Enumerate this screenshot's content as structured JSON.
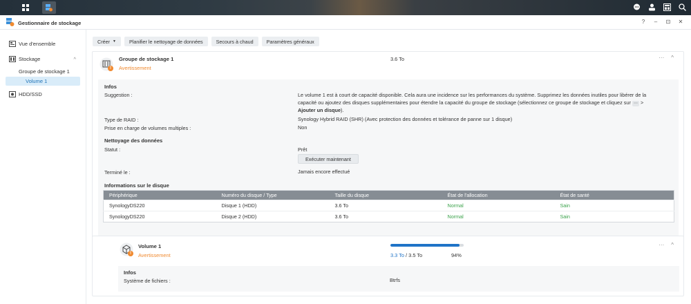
{
  "taskbar": {
    "icons": [
      "apps-grid-icon",
      "storage-manager-app-icon",
      "chat-icon",
      "user-icon",
      "widgets-icon",
      "search-icon"
    ]
  },
  "window": {
    "title": "Gestionnaire de stockage",
    "controls": [
      "?",
      "–",
      "⊡",
      "✕"
    ]
  },
  "sidebar": {
    "overview": "Vue d'ensemble",
    "storage": "Stockage",
    "pool": "Groupe de stockage 1",
    "volume": "Volume 1",
    "hdd": "HDD/SSD"
  },
  "toolbar": {
    "create": "Créer",
    "schedule": "Planifier le nettoyage de données",
    "hotspare": "Secours à chaud",
    "settings": "Paramètres généraux"
  },
  "pool": {
    "title": "Groupe de stockage 1",
    "status": "Avertissement",
    "size": "3.6 To",
    "info_title": "Infos",
    "suggestion_label": "Suggestion :",
    "suggestion_text_1": "Le volume 1 est à court de capacité disponible. Cela aura une incidence sur les performances du système. Supprimez les données inutiles pour libérer de la",
    "suggestion_text_2": "capacité ou ajoutez des disques supplémentaires pour étendre la capacité du groupe de stockage (sélectionnez ce groupe de stockage et cliquez sur",
    "suggestion_kbd": "⋯",
    "suggestion_arrow": ">",
    "suggestion_bold": "Ajouter un disque",
    "suggestion_end": ").",
    "raid_label": "Type de RAID :",
    "raid_value": "Synology Hybrid RAID (SHR) (Avec protection des données et tolérance de panne sur 1 disque)",
    "multivol_label": "Prise en charge de volumes multiples :",
    "multivol_value": "Non",
    "scrub_title": "Nettoyage des données",
    "status_label": "Statut :",
    "status_value": "Prêt",
    "run_now": "Exécuter maintenant",
    "done_label": "Terminé le :",
    "done_value": "Jamais encore effectué",
    "disk_info_title": "Informations sur le disque",
    "columns": [
      "Périphérique",
      "Numéro du disque / Type",
      "Taille du disque",
      "État de l'allocation",
      "État de santé"
    ],
    "rows": [
      [
        "SynologyDS220",
        "Disque 1 (HDD)",
        "3.6 To",
        "Normal",
        "Sain"
      ],
      [
        "SynologyDS220",
        "Disque 2 (HDD)",
        "3.6 To",
        "Normal",
        "Sain"
      ]
    ]
  },
  "volume": {
    "title": "Volume 1",
    "status": "Avertissement",
    "used": "3.3 To",
    "separator": " / ",
    "total": "3.5 To",
    "percent": "94%",
    "usage_fraction": 0.94,
    "info_title": "Infos",
    "fs_label": "Système de fichiers :",
    "fs_value": "Btrfs"
  },
  "colors": {
    "warning": "#f08a30",
    "accent": "#1f73c7",
    "healthy": "#3aa24a"
  }
}
